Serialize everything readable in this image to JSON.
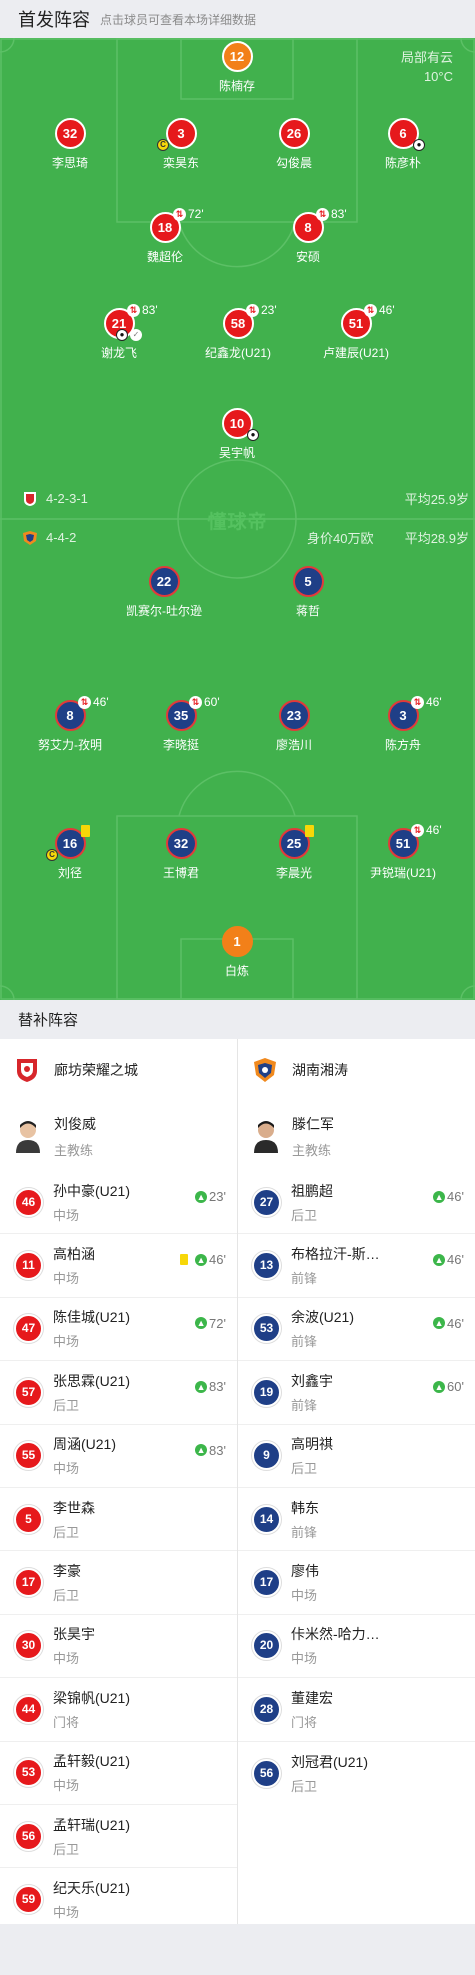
{
  "header": {
    "title": "首发阵容",
    "hint": "点击球员可查看本场详细数据"
  },
  "weather": {
    "condition": "局部有云",
    "temp": "10°C"
  },
  "watermark": "懂球帝",
  "home": {
    "formation": "4-2-3-1",
    "avg_age": "平均25.9岁",
    "name": "廊坊荣耀之城",
    "coach": {
      "name": "刘俊威",
      "role": "主教练"
    },
    "starters": [
      {
        "num": "12",
        "name": "陈楠存",
        "gk": true
      },
      {
        "num": "32",
        "name": "李思琦"
      },
      {
        "num": "3",
        "name": "栾昊东",
        "captain": true
      },
      {
        "num": "26",
        "name": "勾俊晨"
      },
      {
        "num": "6",
        "name": "陈彦朴",
        "goal": true
      },
      {
        "num": "18",
        "name": "魏超伦",
        "sub": "72'"
      },
      {
        "num": "8",
        "name": "安硕",
        "sub": "83'"
      },
      {
        "num": "21",
        "name": "谢龙飞",
        "sub": "83'",
        "goal": true,
        "assist": true
      },
      {
        "num": "58",
        "name": "纪鑫龙(U21)",
        "sub": "23'"
      },
      {
        "num": "51",
        "name": "卢建辰(U21)",
        "sub": "46'"
      },
      {
        "num": "10",
        "name": "吴宇帆",
        "goal": true
      }
    ],
    "subs": [
      {
        "num": "46",
        "name": "孙中豪(U21)",
        "pos": "中场",
        "in": "23'"
      },
      {
        "num": "11",
        "name": "高柏涵",
        "pos": "中场",
        "in": "46'",
        "yellow": true
      },
      {
        "num": "47",
        "name": "陈佳城(U21)",
        "pos": "中场",
        "in": "72'"
      },
      {
        "num": "57",
        "name": "张思霖(U21)",
        "pos": "后卫",
        "in": "83'"
      },
      {
        "num": "55",
        "name": "周涵(U21)",
        "pos": "中场",
        "in": "83'"
      },
      {
        "num": "5",
        "name": "李世森",
        "pos": "后卫"
      },
      {
        "num": "17",
        "name": "李豪",
        "pos": "后卫"
      },
      {
        "num": "30",
        "name": "张昊宇",
        "pos": "中场"
      },
      {
        "num": "44",
        "name": "梁锦帆(U21)",
        "pos": "门将"
      },
      {
        "num": "53",
        "name": "孟轩毅(U21)",
        "pos": "中场"
      },
      {
        "num": "56",
        "name": "孟轩瑞(U21)",
        "pos": "后卫"
      },
      {
        "num": "59",
        "name": "纪天乐(U21)",
        "pos": "中场"
      }
    ]
  },
  "away": {
    "formation": "4-4-2",
    "value": "身价40万欧",
    "avg_age": "平均28.9岁",
    "name": "湖南湘涛",
    "coach": {
      "name": "滕仁军",
      "role": "主教练"
    },
    "starters": [
      {
        "num": "22",
        "name": "凯赛尔-吐尔逊"
      },
      {
        "num": "5",
        "name": "蒋哲"
      },
      {
        "num": "8",
        "name": "努艾力-孜明",
        "sub": "46'"
      },
      {
        "num": "35",
        "name": "李晓挺",
        "sub": "60'"
      },
      {
        "num": "23",
        "name": "廖浩川"
      },
      {
        "num": "3",
        "name": "陈方舟",
        "sub": "46'"
      },
      {
        "num": "16",
        "name": "刘径",
        "captain": true,
        "yellow": true
      },
      {
        "num": "32",
        "name": "王博君"
      },
      {
        "num": "25",
        "name": "李晨光",
        "yellow": true
      },
      {
        "num": "51",
        "name": "尹锐瑞(U21)",
        "sub": "46'"
      },
      {
        "num": "1",
        "name": "白炼",
        "gk": true
      }
    ],
    "subs": [
      {
        "num": "27",
        "name": "祖鹏超",
        "pos": "后卫",
        "in": "46'"
      },
      {
        "num": "13",
        "name": "布格拉汗-斯…",
        "pos": "前锋",
        "in": "46'"
      },
      {
        "num": "53",
        "name": "余波(U21)",
        "pos": "前锋",
        "in": "46'"
      },
      {
        "num": "19",
        "name": "刘鑫宇",
        "pos": "前锋",
        "in": "60'"
      },
      {
        "num": "9",
        "name": "高明祺",
        "pos": "后卫"
      },
      {
        "num": "14",
        "name": "韩东",
        "pos": "前锋"
      },
      {
        "num": "17",
        "name": "廖伟",
        "pos": "中场"
      },
      {
        "num": "20",
        "name": "佧米然-哈力…",
        "pos": "中场"
      },
      {
        "num": "28",
        "name": "董建宏",
        "pos": "门将"
      },
      {
        "num": "56",
        "name": "刘冠君(U21)",
        "pos": "后卫"
      }
    ]
  },
  "subs_header": {
    "title": "替补阵容"
  },
  "colors": {
    "pitch": "#41b14d",
    "home": "#e6191c",
    "away": "#1f3f87",
    "gk_home": "#f28019",
    "sub_arrow": "#3cb64a"
  },
  "icons": {
    "sub_out": "substitution-out-icon",
    "sub_in": "substitution-in-icon",
    "captain": "captain-icon",
    "goal": "goal-icon",
    "yellow": "yellow-card-icon"
  }
}
